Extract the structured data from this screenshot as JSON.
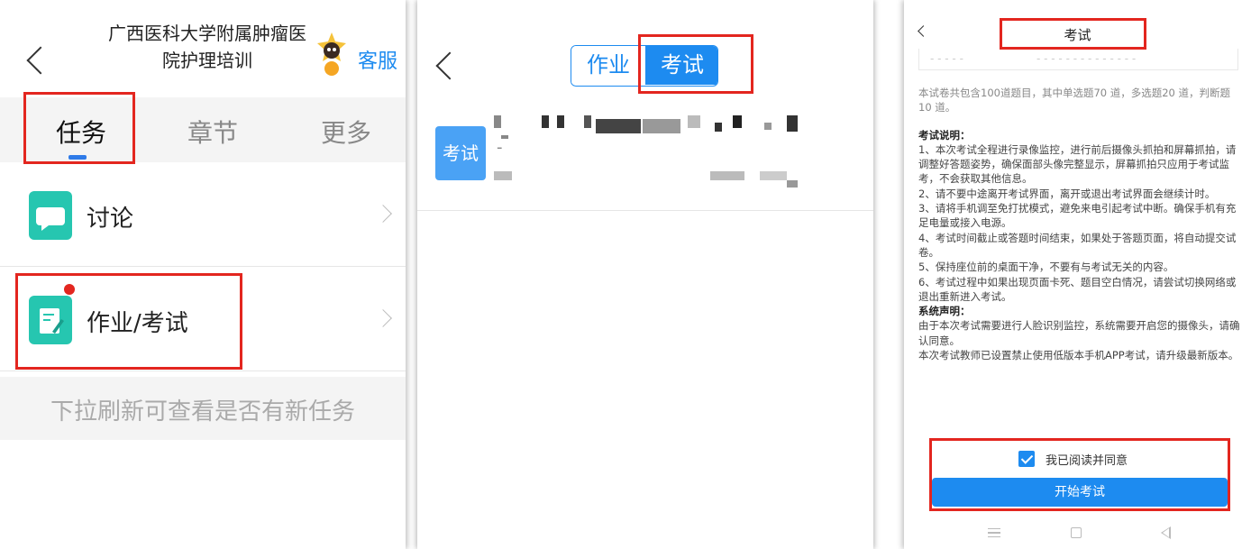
{
  "panel1": {
    "title": "广西医科大学附属肿瘤医院护理培训",
    "service_label": "客服",
    "tabs": [
      "任务",
      "章节",
      "更多"
    ],
    "rows": [
      {
        "label": "讨论",
        "icon": "chat-icon"
      },
      {
        "label": "作业/考试",
        "icon": "edit-icon",
        "has_badge": true
      }
    ],
    "refresh_hint": "下拉刷新可查看是否有新任务"
  },
  "panel2": {
    "segments": [
      "作业",
      "考试"
    ],
    "active_segment": "考试",
    "item_badge": "考试",
    "item_dash": "-"
  },
  "panel3": {
    "title": "考试",
    "intro": "本试卷共包含100道题目，其中单选题70 道，多选题20 道，判断题10 道。",
    "notes_heading": "考试说明：",
    "notes": [
      "1、本次考试全程进行录像监控，进行前后摄像头抓拍和屏幕抓拍，请调整好答题姿势，确保面部头像完整显示，屏幕抓拍只应用于考试监考，不会获取其他信息。",
      "2、请不要中途离开考试界面，离开或退出考试界面会继续计时。",
      "3、请将手机调至免打扰模式，避免来电引起考试中断。确保手机有充足电量或接入电源。",
      "4、考试时间截止或答题时间结束，如果处于答题页面，将自动提交试卷。",
      "5、保持座位前的桌面干净，不要有与考试无关的内容。",
      "6、考试过程中如果出现页面卡死、题目空白情况，请尝试切换网络或退出重新进入考试。"
    ],
    "statement_heading": "系统声明：",
    "statements": [
      "由于本次考试需要进行人脸识别监控，系统需要开启您的摄像头，请确认同意。",
      "本次考试教师已设置禁止使用低版本手机APP考试，请升级最新版本。"
    ],
    "agree_label": "我已阅读并同意",
    "agree_checked": true,
    "start_button": "开始考试"
  },
  "colors": {
    "accent": "#1d8bf0",
    "highlight_red": "#e3261f",
    "icon_teal": "#26c6b0"
  }
}
